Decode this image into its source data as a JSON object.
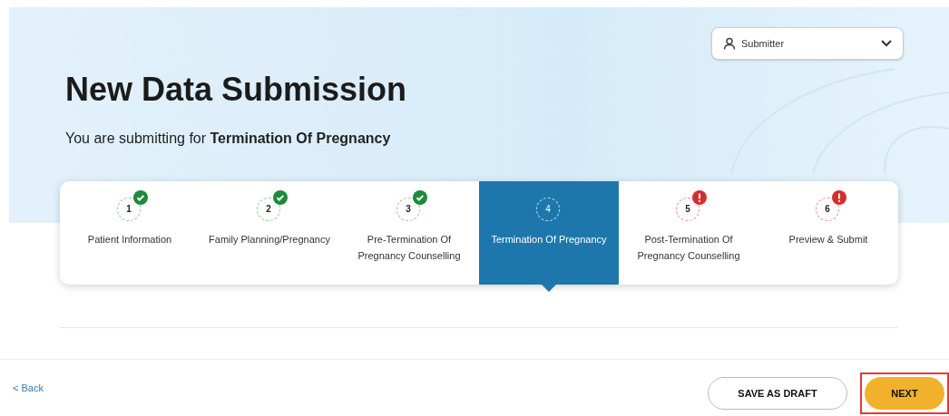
{
  "role_select": {
    "value": "Submitter"
  },
  "title": "New Data Submission",
  "subtitle": "You are submitting for **Termination Of Pregnancy**",
  "steps": [
    {
      "number": "1",
      "label": "Patient Information",
      "completed": true,
      "has_error": false,
      "selected": false
    },
    {
      "number": "2",
      "label": "Family Planning/Pregnancy",
      "completed": true,
      "has_error": false,
      "selected": false
    },
    {
      "number": "3",
      "label": "Pre-Termination Of Pregnancy Counselling",
      "completed": true,
      "has_error": false,
      "selected": false
    },
    {
      "number": "4",
      "label": "Termination Of Pregnancy",
      "completed": false,
      "has_error": false,
      "selected": true
    },
    {
      "number": "5",
      "label": "Post-Termination Of Pregnancy Counselling",
      "completed": false,
      "has_error": true,
      "selected": false
    },
    {
      "number": "6",
      "label": "Preview & Submit",
      "completed": false,
      "has_error": true,
      "selected": false
    }
  ],
  "back_link": "< Back",
  "buttons": [
    {
      "label": "SAVE AS DRAFT",
      "kind": "secondary",
      "highlighted": false
    },
    {
      "label": "NEXT",
      "kind": "primary",
      "highlighted": true
    }
  ]
}
